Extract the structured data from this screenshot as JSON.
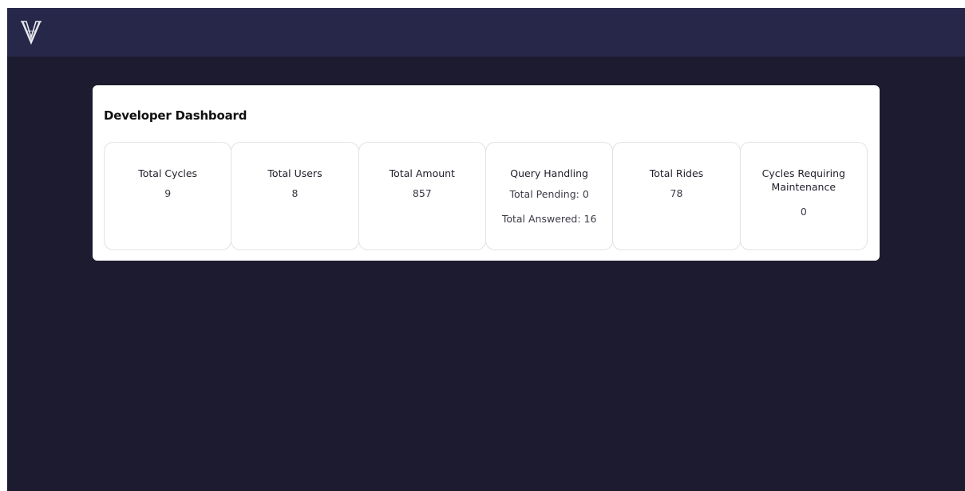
{
  "navbar": {
    "logo_icon": "v-monogram-logo-icon"
  },
  "dashboard": {
    "title": "Developer Dashboard",
    "stats": {
      "total_cycles": {
        "title": "Total Cycles",
        "value": "9"
      },
      "total_users": {
        "title": "Total Users",
        "value": "8"
      },
      "total_amount": {
        "title": "Total Amount",
        "value": "857"
      },
      "query_handling": {
        "title": "Query Handling",
        "pending": "Total Pending: 0",
        "answered": "Total Answered: 16"
      },
      "total_rides": {
        "title": "Total Rides",
        "value": "78"
      },
      "maintenance": {
        "title": "Cycles Requiring Maintenance",
        "value": "0"
      }
    }
  },
  "colors": {
    "page_background": "#1c1b2f",
    "navbar_background": "#27274a",
    "card_background": "#ffffff",
    "stat_border": "#e2e2e8"
  }
}
